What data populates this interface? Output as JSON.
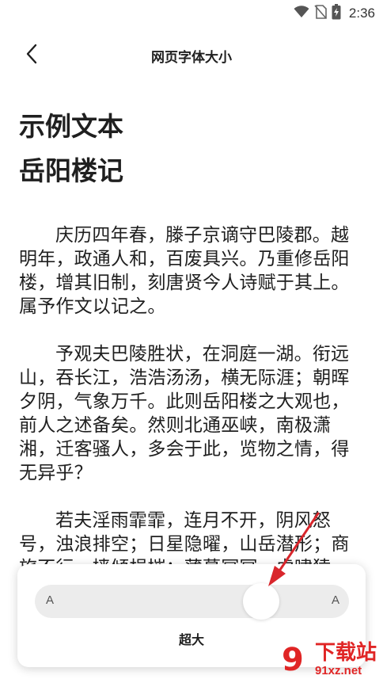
{
  "status_bar": {
    "time": "2:36"
  },
  "app_bar": {
    "title": "网页字体大小"
  },
  "sample": {
    "heading": "示例文本",
    "article_title": "岳阳楼记",
    "paragraphs": [
      "庆历四年春，滕子京谪守巴陵郡。越明年，政通人和，百废具兴。乃重修岳阳楼，增其旧制，刻唐贤今人诗赋于其上。属予作文以记之。",
      "予观夫巴陵胜状，在洞庭一湖。衔远山，吞长江，浩浩汤汤，横无际涯；朝晖夕阴，气象万千。此则岳阳楼之大观也，前人之述备矣。然则北通巫峡，南极潇湘，迁客骚人，多会于此，览物之情，得无异乎？",
      "若夫淫雨霏霏，连月不开，阴风怒号，浊浪排空；日星隐曜，山岳潜形；商旅不行，樯倾楫摧；薄暮冥冥，虎啸猿啼。登斯楼也，则有去国怀乡，忧谗畏讥，满目萧然，感极而悲者矣。"
    ]
  },
  "font_panel": {
    "min_label": "A",
    "max_label": "A",
    "slider_value": 0.75,
    "size_label": "超大"
  },
  "watermark": {
    "title": "下载站",
    "url": "91xz.net"
  },
  "colors": {
    "accent_arrow": "#d9262c",
    "track": "#ececec",
    "watermark": "#e02525"
  }
}
